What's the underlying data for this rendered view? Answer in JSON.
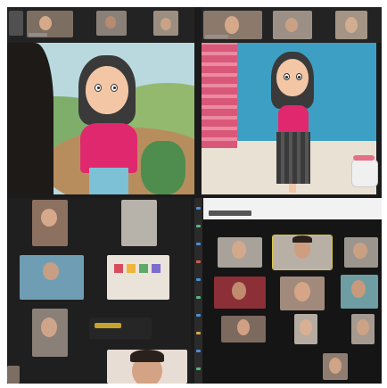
{
  "collage": {
    "title": "",
    "panels": [
      {
        "id": "cartoon-village",
        "kind": "shared-screen"
      },
      {
        "id": "cartoon-pool",
        "kind": "shared-screen"
      },
      {
        "id": "gallery-left",
        "kind": "video-gallery"
      },
      {
        "id": "gallery-right",
        "kind": "video-gallery"
      }
    ]
  },
  "gallery_left": {
    "caption": "",
    "tiles": [
      "",
      "",
      "",
      "",
      "",
      "",
      "",
      "",
      ""
    ]
  },
  "gallery_right": {
    "topbar_text": "",
    "tiles": [
      "",
      "",
      "",
      "",
      "",
      "",
      "",
      "",
      "",
      "",
      ""
    ]
  },
  "colors": {
    "background": "#1b1b1b",
    "shirt": "#e0286f",
    "sky": "#b9d9df",
    "water": "#3e9fc4",
    "active_speaker": "#d6c44a"
  }
}
